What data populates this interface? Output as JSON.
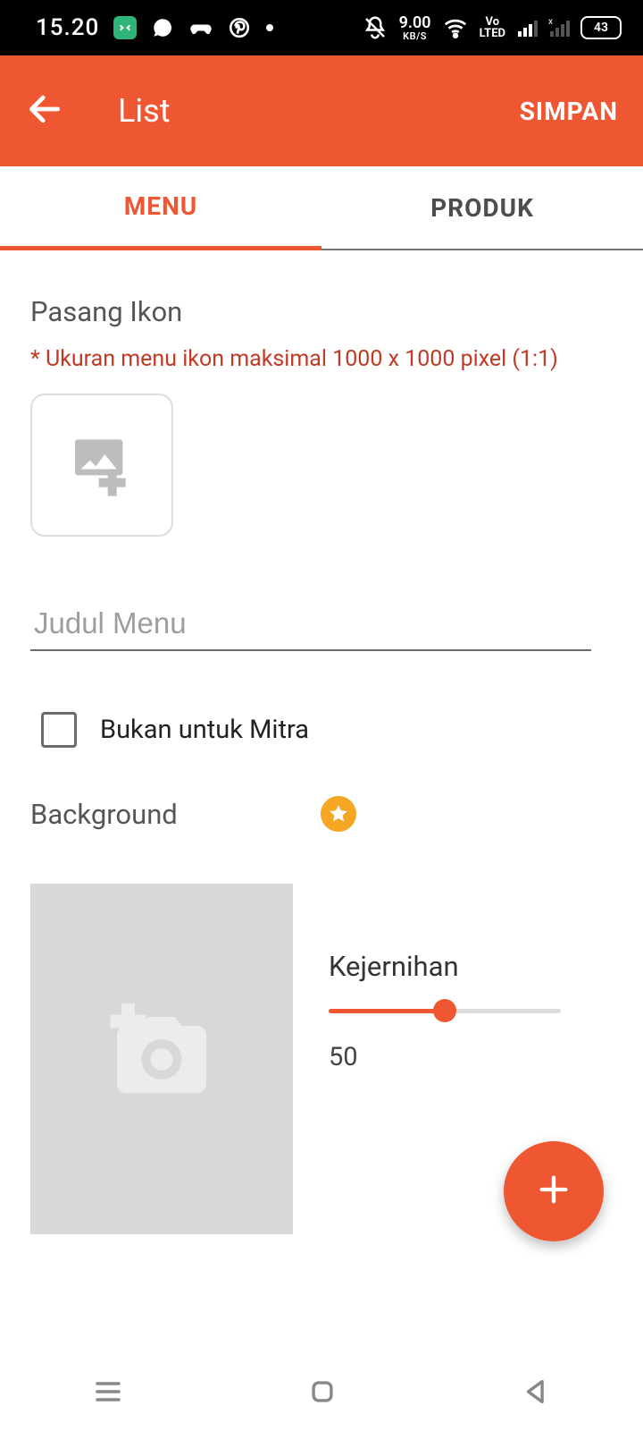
{
  "status": {
    "time": "15.20",
    "net_speed_value": "9.00",
    "net_speed_unit": "KB/S",
    "volte_top": "Vo",
    "volte_bot": "LTED",
    "battery": "43"
  },
  "appbar": {
    "title": "List",
    "save": "SIMPAN"
  },
  "tabs": {
    "menu": "MENU",
    "produk": "PRODUK"
  },
  "section": {
    "pasang_ikon": "Pasang Ikon",
    "hint": "* Ukuran menu ikon maksimal 1000 x 1000 pixel (1:1)",
    "judul_placeholder": "Judul Menu",
    "bukan_mitra": "Bukan untuk Mitra",
    "background": "Background",
    "kejernihan": "Kejernihan",
    "kejernihan_value": "50"
  }
}
